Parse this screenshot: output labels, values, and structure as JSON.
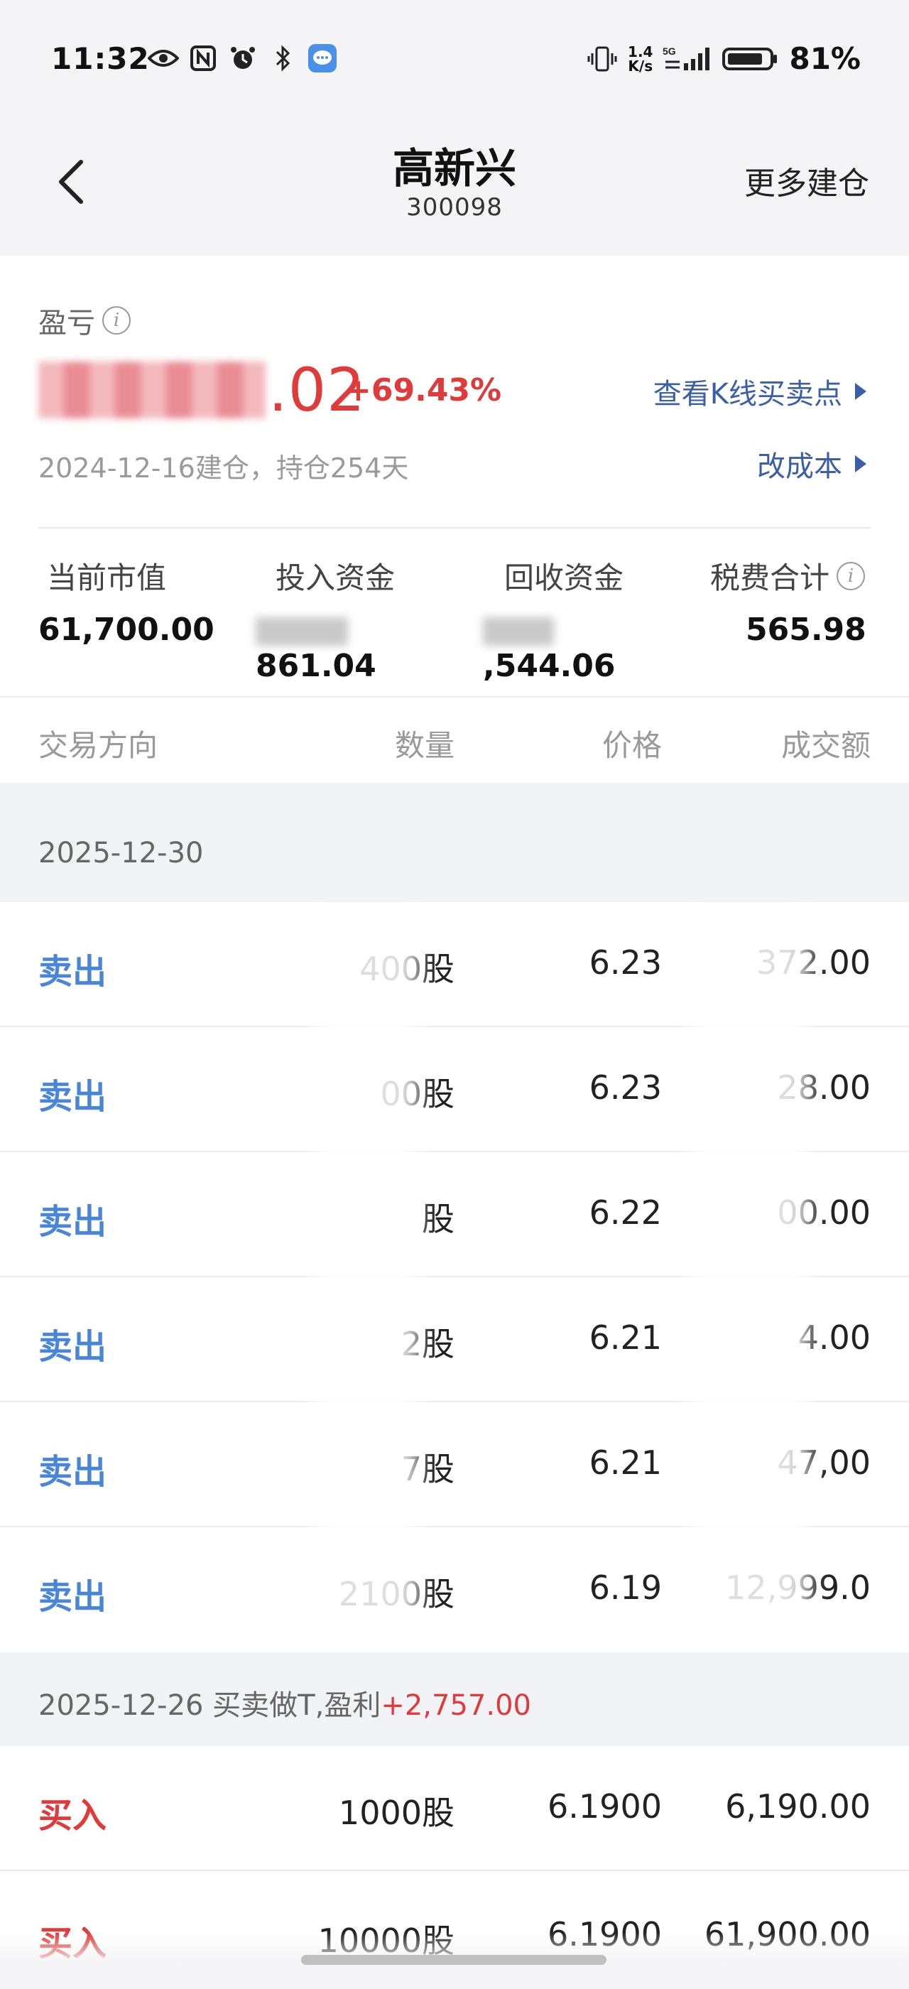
{
  "status": {
    "time": "11:32",
    "net_speed_top": "1.4",
    "net_speed_bottom": "K/s",
    "battery": "81%"
  },
  "header": {
    "title": "高新兴",
    "code": "300098",
    "more_label": "更多建仓"
  },
  "summary": {
    "pl_label": "盈亏",
    "pl_value_visible": ".02",
    "pl_pct": "+69.43%",
    "kline_link": "查看K线买卖点",
    "build_info": "2024-12-16建仓，持仓254天",
    "cost_link": "改成本",
    "stats": [
      {
        "label": "当前市值",
        "value": "61,700.00"
      },
      {
        "label": "投入资金",
        "value": "861.04"
      },
      {
        "label": "回收资金",
        "value": ",544.06"
      },
      {
        "label": "税费合计",
        "value": "565.98"
      }
    ]
  },
  "table": {
    "headers": {
      "direction": "交易方向",
      "qty": "数量",
      "price": "价格",
      "amount": "成交额"
    },
    "groups": [
      {
        "date": "2025-12-30",
        "rows": [
          {
            "dir": "卖出",
            "qty": "400股",
            "price": "6.23",
            "amount": "372.00"
          },
          {
            "dir": "卖出",
            "qty": "00股",
            "price": "6.23",
            "amount": "28.00"
          },
          {
            "dir": "卖出",
            "qty": "股",
            "price": "6.22",
            "amount": "00.00"
          },
          {
            "dir": "卖出",
            "qty": "2股",
            "price": "6.21",
            "amount": "4.00"
          },
          {
            "dir": "卖出",
            "qty": "7股",
            "price": "6.21",
            "amount": "47,00"
          },
          {
            "dir": "卖出",
            "qty": "2100股",
            "price": "6.19",
            "amount": "12,999.0"
          }
        ]
      },
      {
        "date": "2025-12-26 买卖做T,盈利",
        "profit": "+2,757.00",
        "rows": [
          {
            "dir": "买入",
            "qty": "1000股",
            "price": "6.1900",
            "amount": "6,190.00"
          },
          {
            "dir": "买入",
            "qty": "10000股",
            "price": "6.1900",
            "amount": "61,900.00"
          }
        ]
      }
    ]
  },
  "colors": {
    "sell": "#4a86d8",
    "buy": "#e03a3a",
    "link": "#3a5fa8",
    "profit": "#e03a3a"
  }
}
